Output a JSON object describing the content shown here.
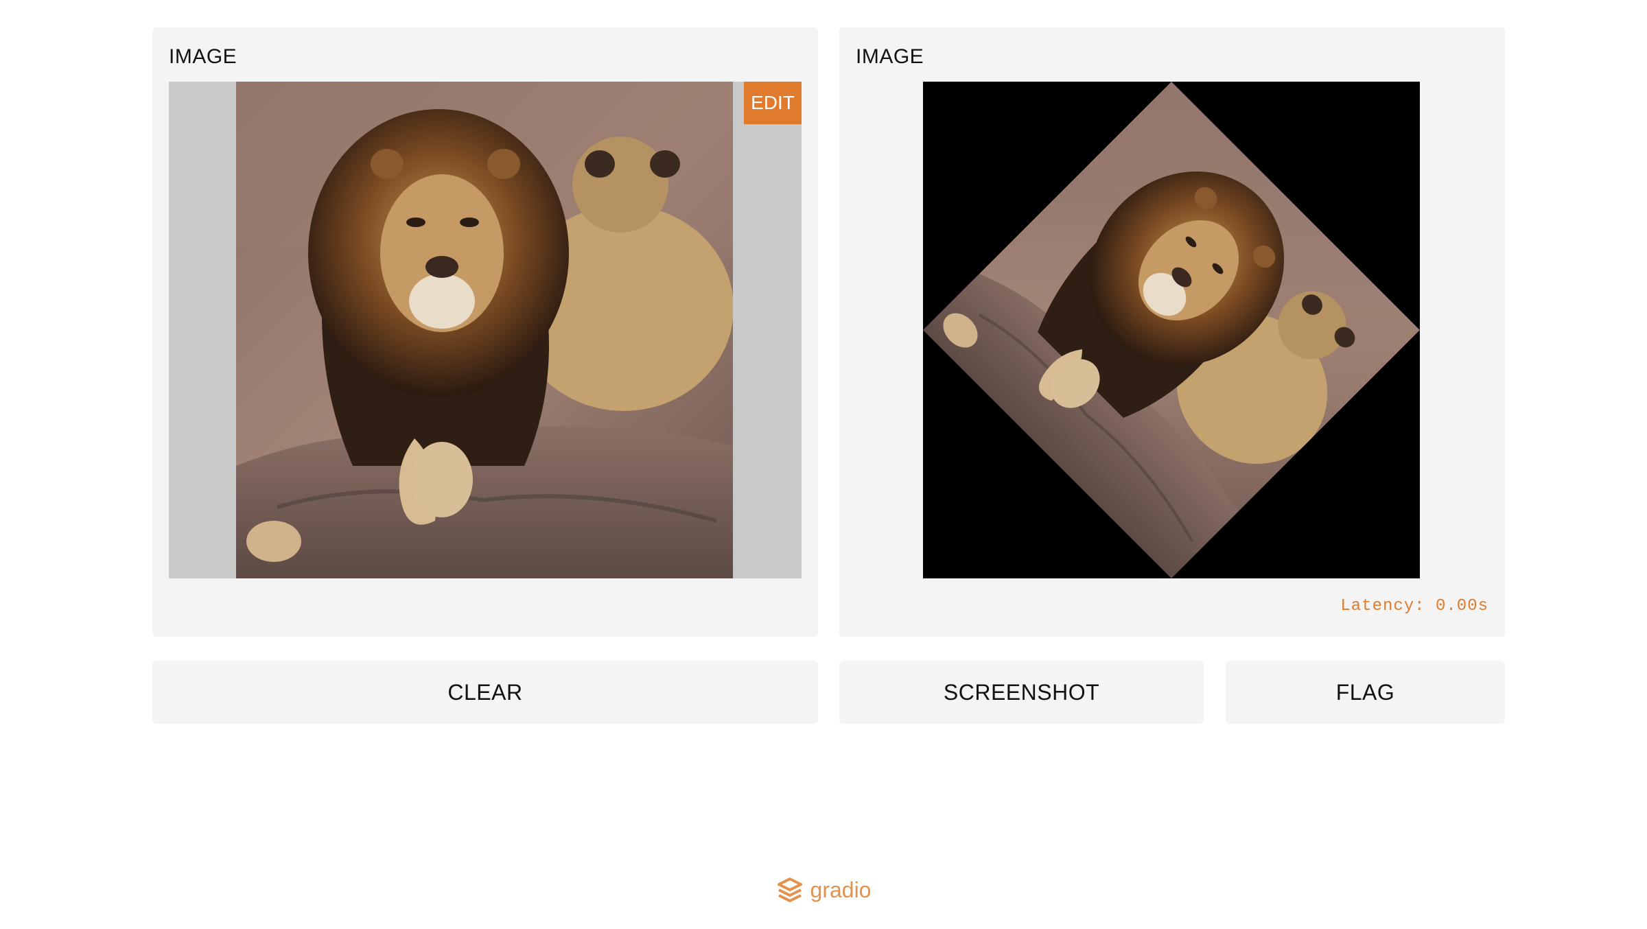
{
  "input_panel": {
    "label": "IMAGE",
    "edit_label": "EDIT"
  },
  "output_panel": {
    "label": "IMAGE",
    "latency": "Latency: 0.00s"
  },
  "buttons": {
    "clear": "CLEAR",
    "screenshot": "SCREENSHOT",
    "flag": "FLAG"
  },
  "footer": {
    "brand": "gradio"
  },
  "colors": {
    "accent": "#e07b2e",
    "panel_bg": "#f4f4f4",
    "letterbox": "#c9c9c9"
  }
}
